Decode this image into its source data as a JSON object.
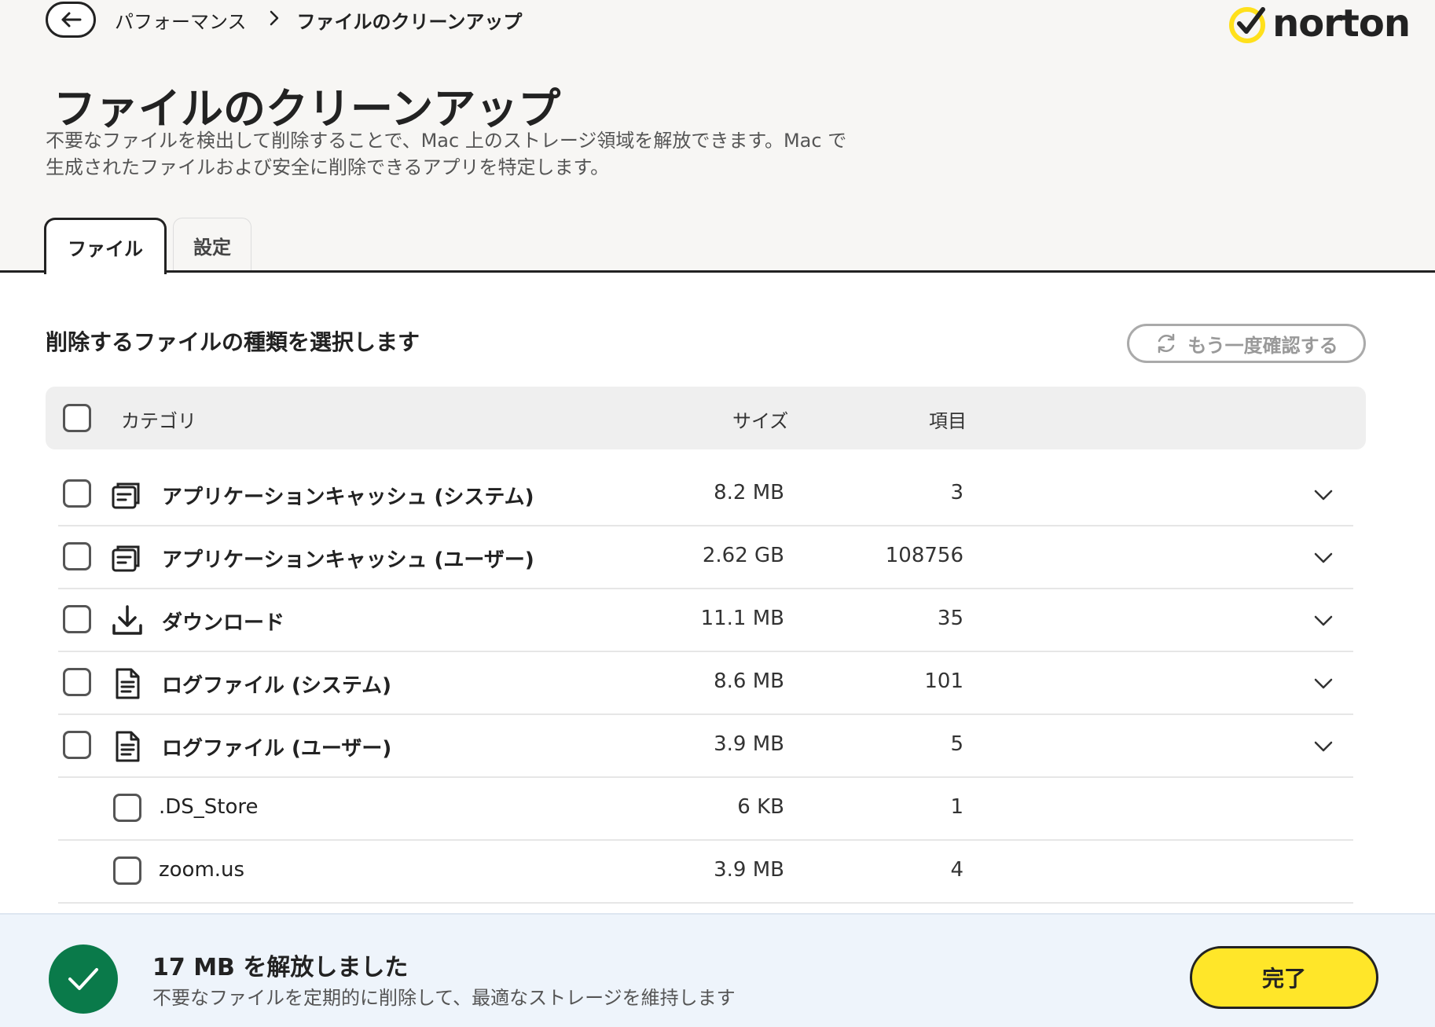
{
  "breadcrumb": {
    "parent": "パフォーマンス",
    "current": "ファイルのクリーンアップ"
  },
  "brand": {
    "name": "norton",
    "accent": "#FFE01B"
  },
  "page": {
    "title": "ファイルのクリーンアップ",
    "description_line1": "不要なファイルを検出して削除することで、Mac 上のストレージ領域を解放できます。Mac で",
    "description_line2": "生成されたファイルおよび安全に削除できるアプリを特定します。"
  },
  "tabs": [
    {
      "label": "ファイル",
      "active": true
    },
    {
      "label": "設定",
      "active": false
    }
  ],
  "section": {
    "title": "削除するファイルの種類を選択します",
    "recheck_label": "もう一度確認する"
  },
  "table": {
    "headers": {
      "category": "カテゴリ",
      "size": "サイズ",
      "items": "項目"
    },
    "rows": [
      {
        "label": "アプリケーションキャッシュ (システム)",
        "size": "8.2 MB",
        "count": "3",
        "icon": "cache-icon",
        "expandable": true,
        "checked": false
      },
      {
        "label": "アプリケーションキャッシュ (ユーザー)",
        "size": "2.62 GB",
        "count": "108756",
        "icon": "cache-icon",
        "expandable": true,
        "checked": false
      },
      {
        "label": "ダウンロード",
        "size": "11.1 MB",
        "count": "35",
        "icon": "download-icon",
        "expandable": true,
        "checked": false
      },
      {
        "label": "ログファイル (システム)",
        "size": "8.6 MB",
        "count": "101",
        "icon": "document-icon",
        "expandable": true,
        "checked": false
      },
      {
        "label": "ログファイル (ユーザー)",
        "size": "3.9 MB",
        "count": "5",
        "icon": "document-icon",
        "expandable": true,
        "checked": false
      }
    ],
    "subrows": [
      {
        "label": ".DS_Store",
        "size": "6 KB",
        "count": "1",
        "checked": false
      },
      {
        "label": "zoom.us",
        "size": "3.9 MB",
        "count": "4",
        "checked": false
      }
    ]
  },
  "footer": {
    "title": "17 MB を解放しました",
    "subtitle": "不要なファイルを定期的に削除して、最適なストレージを維持します",
    "done_label": "完了",
    "status_color": "#0A7A4A",
    "button_color": "#FFE629"
  }
}
